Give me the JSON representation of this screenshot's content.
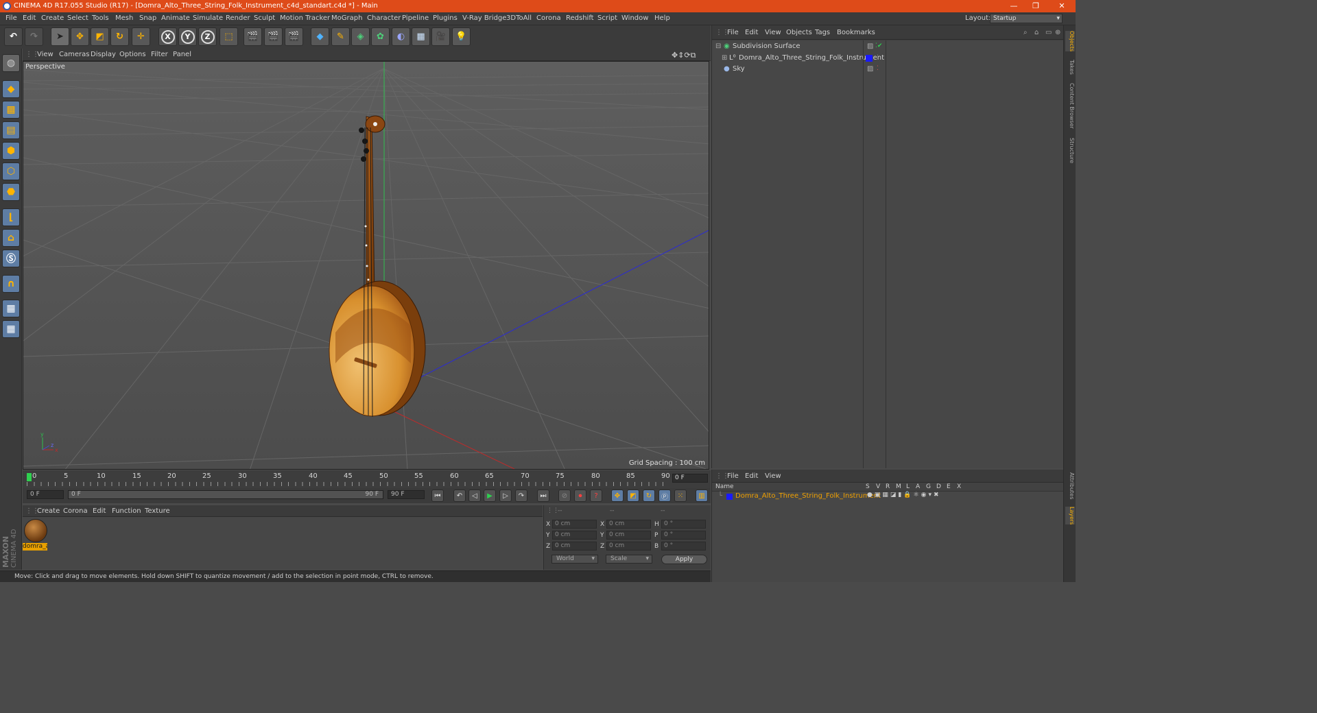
{
  "window": {
    "title": "CINEMA 4D R17.055 Studio (R17) - [Domra_Alto_Three_String_Folk_Instrument_c4d_standart.c4d *] - Main",
    "controls": {
      "minimize": "—",
      "restore": "❐",
      "close": "✕"
    }
  },
  "menubar": {
    "items": [
      "File",
      "Edit",
      "Create",
      "Select",
      "Tools",
      "Mesh",
      "Snap",
      "Animate",
      "Simulate",
      "Render",
      "Sculpt",
      "Motion Tracker",
      "MoGraph",
      "Character",
      "Pipeline",
      "Plugins",
      "V-Ray Bridge",
      "3DToAll",
      "Corona",
      "Redshift",
      "Script",
      "Window",
      "Help"
    ],
    "layout_label": "Layout:",
    "layout_value": "Startup"
  },
  "toolbar": {
    "axis_x": "X",
    "axis_y": "Y",
    "axis_z": "Z"
  },
  "viewport": {
    "menu": [
      "View",
      "Cameras",
      "Display",
      "Options",
      "Filter",
      "Panel"
    ],
    "camera_label": "Perspective",
    "grid_spacing": "Grid Spacing : 100 cm"
  },
  "timeline": {
    "ticks": [
      "0",
      "5",
      "10",
      "15",
      "20",
      "25",
      "30",
      "35",
      "40",
      "45",
      "50",
      "55",
      "60",
      "65",
      "70",
      "75",
      "80",
      "85",
      "90"
    ],
    "current_frame": "0 F",
    "start_field": "0 F",
    "range_start": "0 F",
    "range_end": "90 F",
    "end_field": "90 F"
  },
  "material_manager": {
    "menu": [
      "Create",
      "Corona",
      "Edit",
      "Function",
      "Texture"
    ],
    "materials": [
      {
        "name": "domra_alto"
      }
    ]
  },
  "coordinates": {
    "headers": [
      "--",
      "--",
      "--"
    ],
    "rows": [
      {
        "a": "X",
        "av": "0 cm",
        "b": "X",
        "bv": "0 cm",
        "c": "H",
        "cv": "0 °"
      },
      {
        "a": "Y",
        "av": "0 cm",
        "b": "Y",
        "bv": "0 cm",
        "c": "P",
        "cv": "0 °"
      },
      {
        "a": "Z",
        "av": "0 cm",
        "b": "Z",
        "bv": "0 cm",
        "c": "B",
        "cv": "0 °"
      }
    ],
    "mode": "World",
    "transform": "Scale",
    "apply": "Apply"
  },
  "status": {
    "text": "Move: Click and drag to move elements. Hold down SHIFT to quantize movement / add to the selection in point mode, CTRL to remove."
  },
  "brand": {
    "line1": "MAXON",
    "line2": "CINEMA 4D"
  },
  "object_manager": {
    "menu": [
      "File",
      "Edit",
      "View",
      "Objects",
      "Tags",
      "Bookmarks"
    ],
    "objects": [
      {
        "name": "Subdivision Surface"
      },
      {
        "name": "Domra_Alto_Three_String_Folk_Instrument"
      },
      {
        "name": "Sky"
      }
    ]
  },
  "layer_manager": {
    "menu": [
      "File",
      "Edit",
      "View"
    ],
    "columns": [
      "Name",
      "S",
      "V",
      "R",
      "M",
      "L",
      "A",
      "G",
      "D",
      "E",
      "X"
    ],
    "layers": [
      {
        "name": "Domra_Alto_Three_String_Folk_Instrument",
        "color": "#1a1aff"
      }
    ]
  },
  "right_tabs": {
    "top": [
      "Objects",
      "Takes",
      "Content Browser",
      "Structure"
    ],
    "bottom": [
      "Attributes",
      "Layers"
    ]
  },
  "colors": {
    "titlebar": "#de4b19",
    "accent": "#f0a000",
    "selected_tab": "#ffb400"
  }
}
